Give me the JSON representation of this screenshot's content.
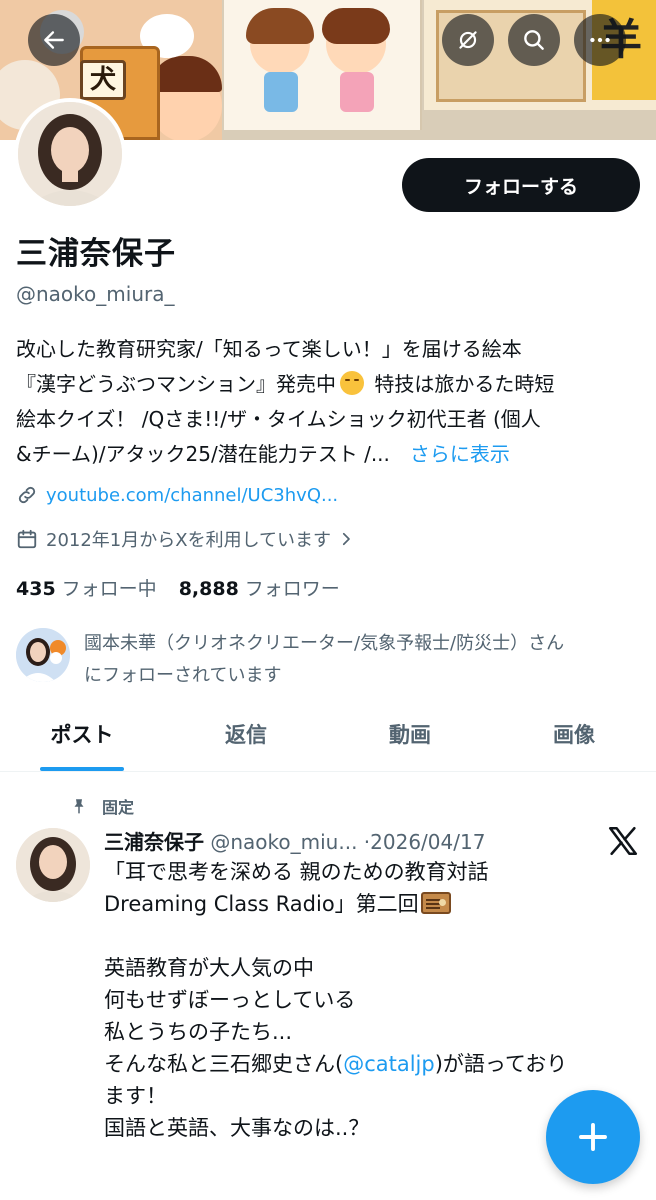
{
  "header": {
    "banner_sign_text": "犬",
    "banner_right_text": "羊",
    "back_icon": "arrow-left-icon",
    "actions": [
      "timeline-icon",
      "search-icon",
      "more-icon"
    ]
  },
  "profile": {
    "follow_label": "フォローする",
    "display_name": "三浦奈保子",
    "handle": "@naoko_miura_",
    "bio_line1": "改心した教育研究家/「知るって楽しい！」を届ける絵本",
    "bio_line2a": "『漢字どうぶつマンション』発売中",
    "bio_line2b": " 特技は旅かるた時短",
    "bio_line3": "絵本クイズ！ /Qさま!!/ザ・タイムショック初代王者 (個人",
    "bio_line4": "&チーム)/アタック25/潜在能力テスト /...",
    "bio_more": "さらに表示",
    "link": "youtube.com/channel/UC3hvQ...",
    "joined": "2012年1月からXを利用しています",
    "following_count": "435",
    "following_label": "フォロー中",
    "followers_count": "8,888",
    "followers_label": "フォロワー",
    "followed_by_line1": "國本未華（クリオネクリエーター/気象予報士/防災士）さん",
    "followed_by_line2": "にフォローされています"
  },
  "tabs": [
    {
      "label": "ポスト",
      "active": true
    },
    {
      "label": "返信",
      "active": false
    },
    {
      "label": "動画",
      "active": false
    },
    {
      "label": "画像",
      "active": false
    }
  ],
  "tweet": {
    "pinned_label": "固定",
    "author_name": "三浦奈保子",
    "author_handle": "@naoko_miu...",
    "date_sep": "·",
    "date": "2026/04/17",
    "line1": "「耳で思考を深める 親のための教育対話",
    "line2": "Dreaming Class Radio」第二回",
    "line3": "英語教育が大人気の中",
    "line4": "何もせずぼーっとしている",
    "line5": "私とうちの子たち...",
    "line6a": "そんな私と三石郷史さん(",
    "mention": "@cataljp",
    "line6b": ")が語っており",
    "line7": "ます！",
    "line8": "国語と英語、大事なのは..？"
  },
  "colors": {
    "accent": "#1d9bf0",
    "text_primary": "#0f1419",
    "text_secondary": "#536471",
    "follow_button": "#0f1419"
  }
}
